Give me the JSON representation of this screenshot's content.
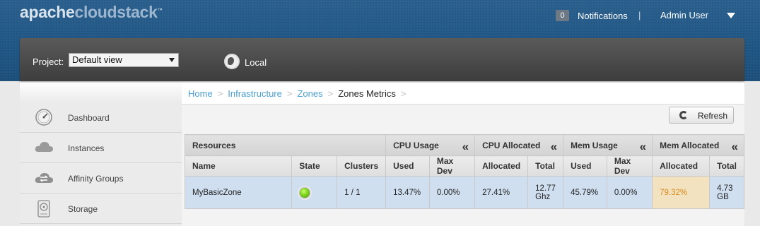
{
  "header": {
    "logo_part1": "apache",
    "logo_part2": "cloudstack",
    "logo_tm": "™",
    "notifications_count": "0",
    "notifications_label": "Notifications",
    "separator": "|",
    "user_name": "Admin User"
  },
  "project_bar": {
    "project_label": "Project:",
    "project_value": "Default view",
    "zone_label": "Local"
  },
  "sidebar": {
    "items": [
      {
        "label": "Dashboard",
        "icon": "gauge-icon"
      },
      {
        "label": "Instances",
        "icon": "cloud-icon"
      },
      {
        "label": "Affinity Groups",
        "icon": "affinity-cloud-icon"
      },
      {
        "label": "Storage",
        "icon": "disk-icon"
      }
    ]
  },
  "breadcrumb": {
    "items": [
      "Home",
      "Infrastructure",
      "Zones"
    ],
    "current": "Zones Metrics",
    "sep": ">"
  },
  "toolbar": {
    "refresh_label": "Refresh"
  },
  "table": {
    "groups": {
      "resources": "Resources",
      "cpu_usage": "CPU Usage",
      "cpu_allocated": "CPU Allocated",
      "mem_usage": "Mem Usage",
      "mem_allocated": "Mem Allocated",
      "collapse": "«"
    },
    "columns": [
      "Name",
      "State",
      "Clusters",
      "Used",
      "Max Dev",
      "Allocated",
      "Total",
      "Used",
      "Max Dev",
      "Allocated",
      "Total"
    ],
    "rows": [
      {
        "name": "MyBasicZone",
        "state": "enabled",
        "clusters": "1 / 1",
        "cpu_used": "13.47%",
        "cpu_maxdev": "0.00%",
        "cpu_allocated": "27.41%",
        "cpu_total": "12.77 Ghz",
        "mem_used": "45.79%",
        "mem_maxdev": "0.00%",
        "mem_allocated": "79.32%",
        "mem_total": "4.73 GB"
      }
    ]
  },
  "colors": {
    "header_blue": "#1f5583",
    "link_blue": "#4a9fd4",
    "row_blue": "#cfdff0",
    "warn_bg": "#f3e2c0",
    "warn_text": "#d88b1f",
    "state_green": "#7fd11f"
  }
}
